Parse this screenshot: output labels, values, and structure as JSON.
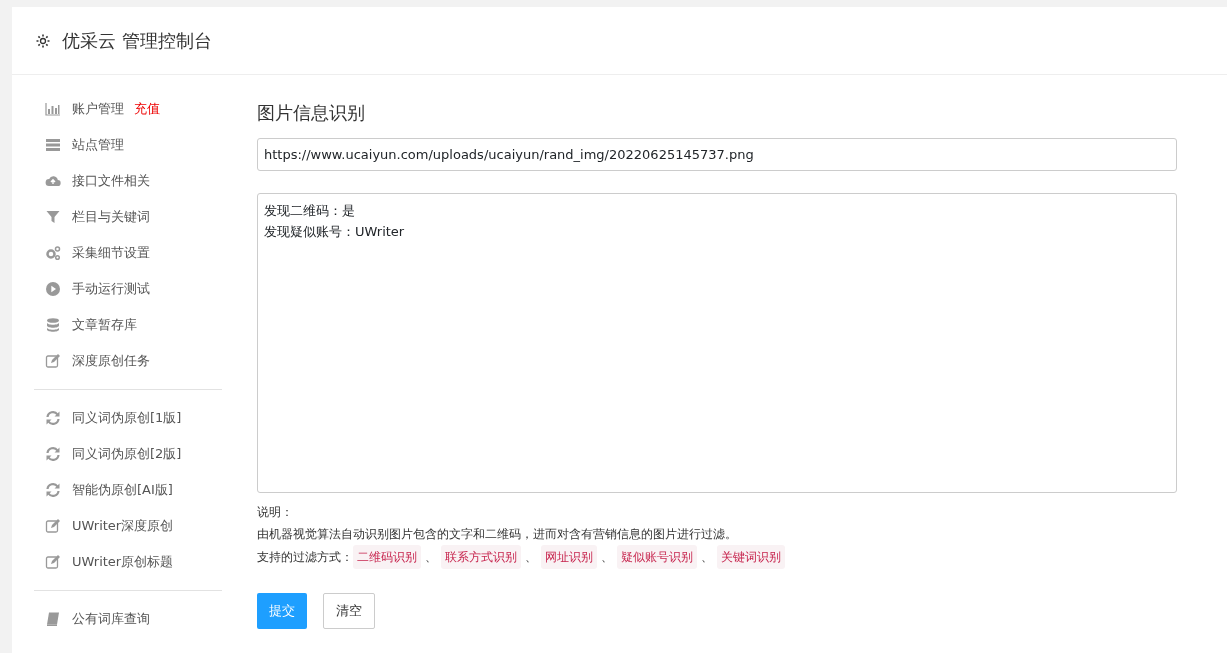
{
  "header": {
    "title": "优采云 管理控制台"
  },
  "sidebar": {
    "items": [
      {
        "label": "账户管理",
        "badge": "充值"
      },
      {
        "label": "站点管理"
      },
      {
        "label": "接口文件相关"
      },
      {
        "label": "栏目与关键词"
      },
      {
        "label": "采集细节设置"
      },
      {
        "label": "手动运行测试"
      },
      {
        "label": "文章暂存库"
      },
      {
        "label": "深度原创任务",
        "divider_after": true
      },
      {
        "label": "同义词伪原创[1版]"
      },
      {
        "label": "同义词伪原创[2版]"
      },
      {
        "label": "智能伪原创[AI版]"
      },
      {
        "label": "UWriter深度原创"
      },
      {
        "label": "UWriter原创标题",
        "divider_after": true
      },
      {
        "label": "公有词库查询"
      }
    ]
  },
  "main": {
    "title": "图片信息识别",
    "url_field": {
      "value": "https://www.ucaiyun.com/uploads/ucaiyun/rand_img/20220625145737.png"
    },
    "result_field": {
      "lines": [
        "发现二维码：是",
        "发现疑似账号：UWriter"
      ]
    },
    "notes_heading": "说明：",
    "notes_text": "由机器视觉算法自动识别图片包含的文字和二维码，进而对含有营销信息的图片进行过滤。",
    "filters_label": "支持的过滤方式：",
    "filters": [
      "二维码识别",
      "联系方式识别",
      "网址识别",
      "疑似账号识别",
      "关键词识别"
    ],
    "separator": "、",
    "buttons": [
      {
        "kind": "primary",
        "label": "提交"
      },
      {
        "kind": "secondary",
        "label": "清空"
      }
    ]
  }
}
